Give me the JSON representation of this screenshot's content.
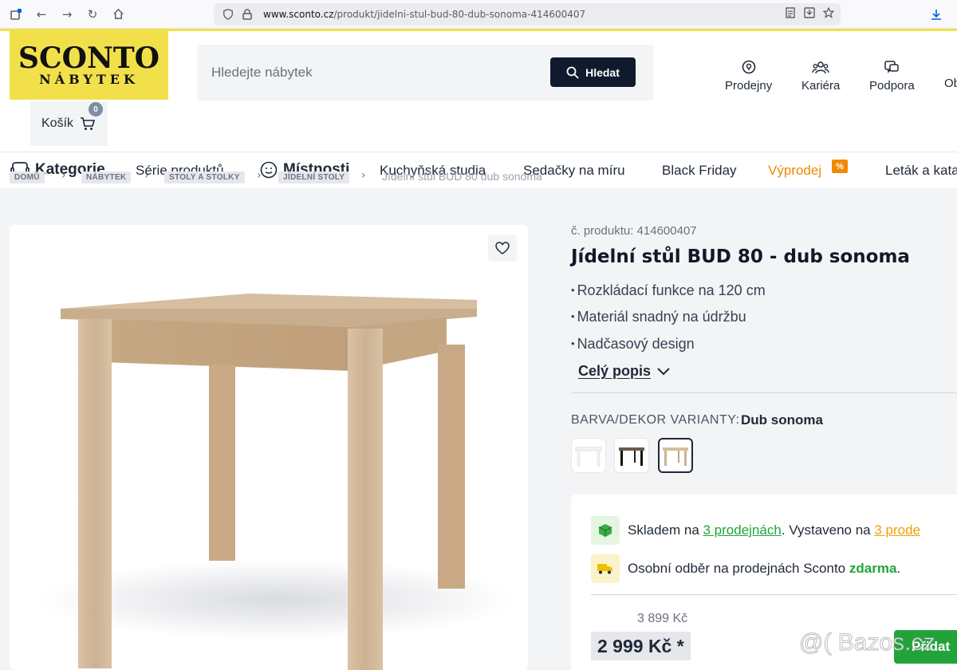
{
  "browser": {
    "url_domain": "www.sconto.cz",
    "url_path": "/produkt/jidelni-stul-bud-80-dub-sonoma-414600407"
  },
  "header": {
    "logo_top": "SCONTO",
    "logo_bottom": "NÁBYTEK",
    "search_placeholder": "Hledejte nábytek",
    "search_button": "Hledat",
    "nav": [
      "Prodejny",
      "Kariéra",
      "Podpora",
      "Ob"
    ],
    "cart_label": "Košík",
    "cart_count": "0"
  },
  "main_nav": {
    "categories": "Kategorie",
    "series": "Série produktů",
    "rooms": "Místnosti",
    "kitchen": "Kuchyňská studia",
    "sofas": "Sedačky na míru",
    "black_friday": "Black Friday",
    "sale": "Výprodej",
    "sale_badge": "%",
    "leaflet": "Leták a kata"
  },
  "breadcrumb": [
    "DOMŮ",
    "NÁBYTEK",
    "STOLY A STOLKY",
    "JÍDELNÍ STOLY",
    "Jídelní stůl BUD 80 dub sonoma"
  ],
  "product": {
    "sku": "č. produktu: 414600407",
    "title": "Jídelní stůl BUD 80 - dub sonoma",
    "features": [
      "Rozkládací funkce na 120 cm",
      "Materiál snadný na údržbu",
      "Nadčasový design"
    ],
    "full_description": "Celý popis",
    "variant_label": "BARVA/DEKOR VARIANTY:",
    "variant_value": "Dub sonoma",
    "swatches": [
      "white",
      "black",
      "sonoma"
    ]
  },
  "availability": {
    "stock_prefix": "Skladem na ",
    "stock_link": "3 prodejnách",
    "stock_mid": ". Vystaveno na ",
    "display_link": "3 prode",
    "pickup_prefix": "Osobní odběr na prodejnách Sconto ",
    "pickup_free": "zdarma",
    "pickup_suffix": "."
  },
  "price": {
    "old": "3 899 Kč",
    "current": "2 999 Kč *",
    "add_button": "Přidat"
  },
  "watermark": "@( Bazos.cz",
  "colors": {
    "brand_yellow": "#f2e04b",
    "dark_navy": "#0f1b2d",
    "green": "#22a33a",
    "orange": "#f08a00"
  }
}
